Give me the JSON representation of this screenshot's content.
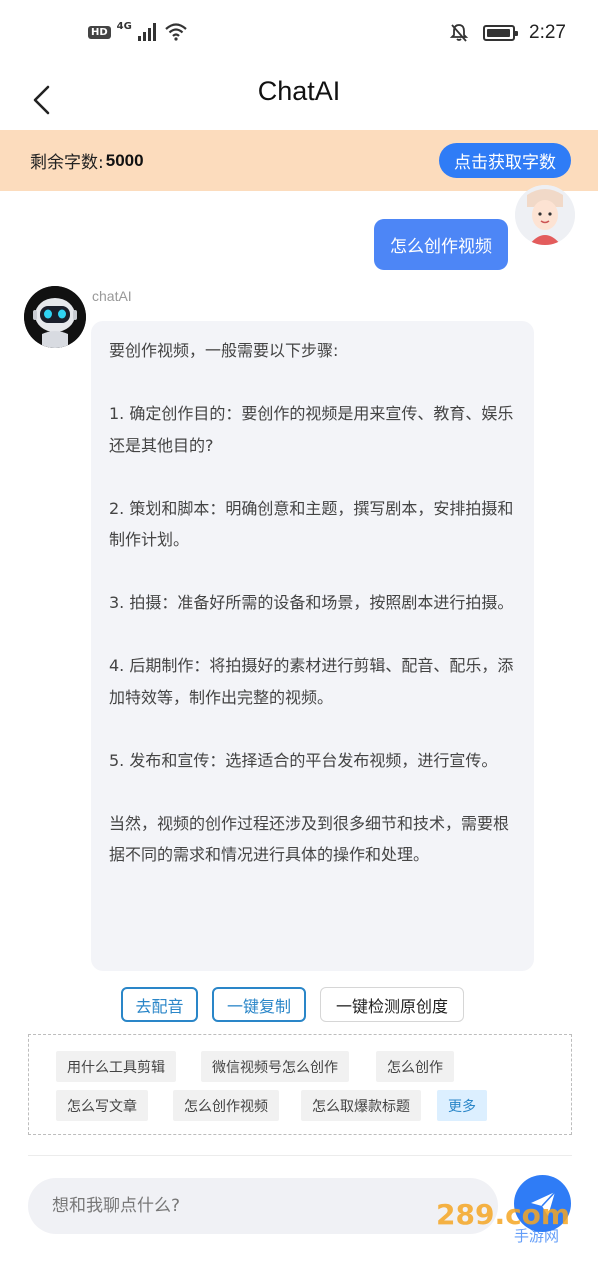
{
  "status_bar": {
    "network_badge": "HD",
    "network_type": "4G",
    "time": "2:27",
    "battery_level": 0.95
  },
  "nav": {
    "title": "ChatAI"
  },
  "quota": {
    "label": "剩余字数:",
    "value": "5000",
    "button_label": "点击获取字数"
  },
  "chat": {
    "user_message": "怎么创作视频",
    "bot_name": "chatAI",
    "bot_paragraphs": [
      "要创作视频，一般需要以下步骤:",
      "1. 确定创作目的：要创作的视频是用来宣传、教育、娱乐还是其他目的?",
      "2. 策划和脚本：明确创意和主题，撰写剧本，安排拍摄和制作计划。",
      "3. 拍摄：准备好所需的设备和场景，按照剧本进行拍摄。",
      "4. 后期制作：将拍摄好的素材进行剪辑、配音、配乐，添加特效等，制作出完整的视频。",
      "5. 发布和宣传：选择适合的平台发布视频，进行宣传。",
      "当然，视频的创作过程还涉及到很多细节和技术，需要根据不同的需求和情况进行具体的操作和处理。"
    ]
  },
  "actions": {
    "dub": "去配音",
    "copy": "一键复制",
    "originality": "一键检测原创度"
  },
  "suggestions": {
    "items": [
      "用什么工具剪辑",
      "微信视频号怎么创作",
      "怎么创作",
      "怎么写文章",
      "怎么创作视频",
      "怎么取爆款标题"
    ],
    "more": "更多"
  },
  "input": {
    "placeholder": "想和我聊点什么?"
  },
  "watermark": {
    "logo_text": "289.com",
    "sub_text": "手游网"
  },
  "colors": {
    "accent_blue": "#2f7cf6",
    "quota_bg": "#fcdcbd",
    "action_blue": "#2a86c8"
  }
}
